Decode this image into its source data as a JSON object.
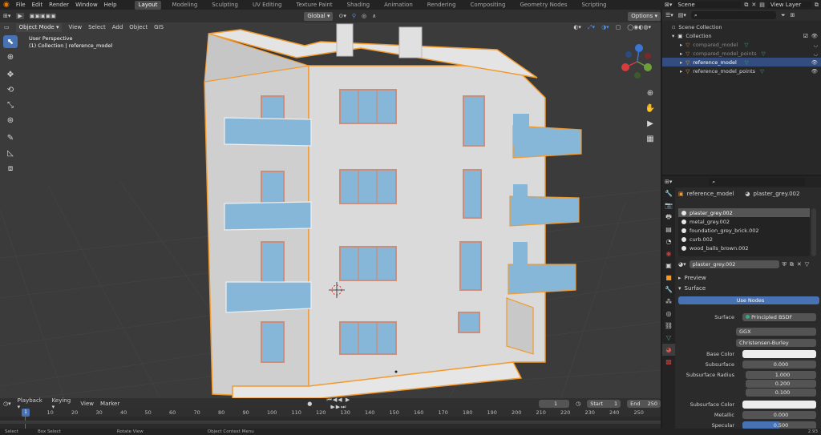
{
  "menu": [
    "File",
    "Edit",
    "Render",
    "Window",
    "Help"
  ],
  "workspaces": [
    {
      "label": "Layout",
      "active": true
    },
    {
      "label": "Modeling",
      "active": false
    },
    {
      "label": "Sculpting",
      "active": false
    },
    {
      "label": "UV Editing",
      "active": false
    },
    {
      "label": "Texture Paint",
      "active": false
    },
    {
      "label": "Shading",
      "active": false
    },
    {
      "label": "Animation",
      "active": false
    },
    {
      "label": "Rendering",
      "active": false
    },
    {
      "label": "Compositing",
      "active": false
    },
    {
      "label": "Geometry Nodes",
      "active": false
    },
    {
      "label": "Scripting",
      "active": false
    }
  ],
  "scene": {
    "label": "Scene",
    "view_layer": "View Layer"
  },
  "viewport": {
    "mode": "Object Mode",
    "header_menus": [
      "View",
      "Select",
      "Add",
      "Object",
      "GIS"
    ],
    "transform_orientation": "Global",
    "options_label": "Options",
    "view_name": "User Perspective",
    "collection_info": "(1) Collection | reference_model"
  },
  "outliner": {
    "search_placeholder": "",
    "rows": [
      {
        "label": "Scene Collection",
        "indent": 0,
        "selected": false,
        "dim": false,
        "icon": "scene-collection-icon"
      },
      {
        "label": "Collection",
        "indent": 1,
        "selected": false,
        "dim": false,
        "icon": "collection-icon"
      },
      {
        "label": "compared_model",
        "indent": 2,
        "selected": false,
        "dim": true,
        "icon": "mesh-icon"
      },
      {
        "label": "compared_model_points",
        "indent": 2,
        "selected": false,
        "dim": true,
        "icon": "mesh-icon"
      },
      {
        "label": "reference_model",
        "indent": 2,
        "selected": true,
        "dim": false,
        "icon": "mesh-icon"
      },
      {
        "label": "reference_model_points",
        "indent": 2,
        "selected": false,
        "dim": false,
        "icon": "mesh-icon"
      }
    ]
  },
  "properties": {
    "object_name": "reference_model",
    "material_name": "plaster_grey.002",
    "materials": [
      "plaster_grey.002",
      "metal_grey.002",
      "foundation_grey_brick.002",
      "curb.002",
      "wood_balls_brown.002"
    ],
    "slot_material": "plaster_grey.002",
    "preview_label": "Preview",
    "surface_label": "Surface",
    "use_nodes_label": "Use Nodes",
    "fields": [
      {
        "label": "Surface",
        "value": "Principled BSDF"
      },
      {
        "label": "",
        "value": "GGX"
      },
      {
        "label": "",
        "value": "Christensen-Burley"
      },
      {
        "label": "Base Color",
        "value": ""
      },
      {
        "label": "Subsurface",
        "value": "0.000"
      },
      {
        "label": "Subsurface Radius",
        "value": "1.000"
      },
      {
        "label": "",
        "value": "0.200"
      },
      {
        "label": "",
        "value": "0.100"
      },
      {
        "label": "Subsurface Color",
        "value": ""
      },
      {
        "label": "Metallic",
        "value": "0.000"
      },
      {
        "label": "Specular",
        "value": "0.500"
      }
    ]
  },
  "timeline": {
    "menus": [
      "Playback",
      "Keying",
      "View",
      "Marker"
    ],
    "current_frame": "1",
    "start_label": "Start",
    "start": "1",
    "end_label": "End",
    "end": "250",
    "ticks": [
      "1",
      "10",
      "20",
      "30",
      "40",
      "50",
      "60",
      "70",
      "80",
      "90",
      "100",
      "110",
      "120",
      "130",
      "140",
      "150",
      "160",
      "170",
      "180",
      "190",
      "200",
      "210",
      "220",
      "230",
      "240",
      "250"
    ]
  },
  "status": {
    "select": "Select",
    "box_select": "Box Select",
    "rotate_view": "Rotate View",
    "context_menu": "Object Context Menu",
    "version": "2.93"
  },
  "colors": {
    "accent": "#4772b3",
    "selection_orange": "#f29a2e",
    "building_wall": "#d8d8d8",
    "window_glass": "#86b7d8",
    "window_frame": "#c98f7c"
  }
}
